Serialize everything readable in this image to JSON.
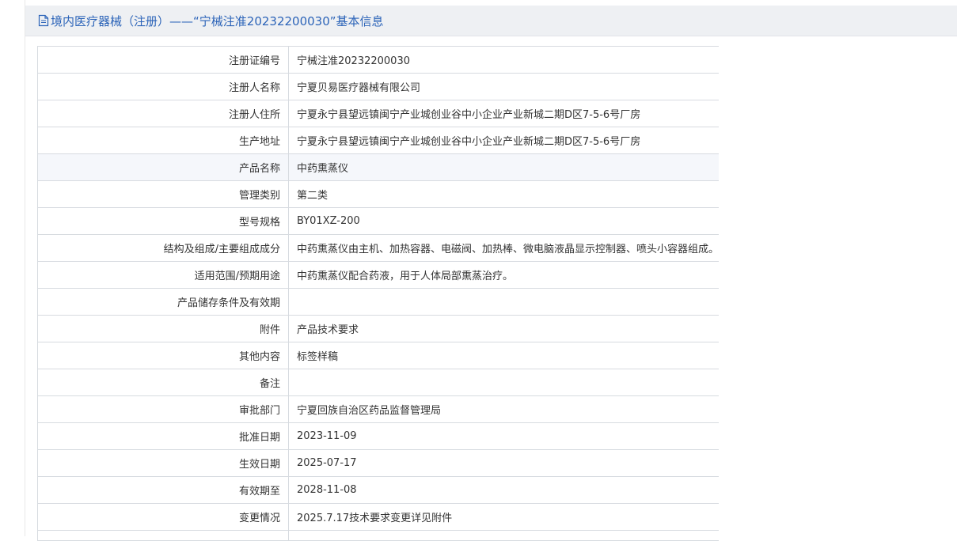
{
  "header": {
    "icon": "document-icon",
    "title": "境内医疗器械（注册）——“宁械注准20232200030”基本信息",
    "accent": "#2b63b8"
  },
  "rows": [
    {
      "label": "注册证编号",
      "value": "宁械注准20232200030"
    },
    {
      "label": "注册人名称",
      "value": "宁夏贝易医疗器械有限公司"
    },
    {
      "label": "注册人住所",
      "value": "宁夏永宁县望远镇闽宁产业城创业谷中小企业产业新城二期D区7-5-6号厂房"
    },
    {
      "label": "生产地址",
      "value": "宁夏永宁县望远镇闽宁产业城创业谷中小企业产业新城二期D区7-5-6号厂房"
    },
    {
      "label": "产品名称",
      "value": "中药熏蒸仪"
    },
    {
      "label": "管理类别",
      "value": "第二类"
    },
    {
      "label": "型号规格",
      "value": "BY01XZ-200"
    },
    {
      "label": "结构及组成/主要组成成分",
      "value": "中药熏蒸仪由主机、加热容器、电磁阀、加热棒、微电脑液晶显示控制器、喷头小容器组成。"
    },
    {
      "label": "适用范围/预期用途",
      "value": "中药熏蒸仪配合药液，用于人体局部熏蒸治疗。"
    },
    {
      "label": "产品储存条件及有效期",
      "value": ""
    },
    {
      "label": "附件",
      "value": "产品技术要求"
    },
    {
      "label": "其他内容",
      "value": "标签样稿"
    },
    {
      "label": "备注",
      "value": ""
    },
    {
      "label": "审批部门",
      "value": "宁夏回族自治区药品监督管理局"
    },
    {
      "label": "批准日期",
      "value": "2023-11-09"
    },
    {
      "label": "生效日期",
      "value": "2025-07-17"
    },
    {
      "label": "有效期至",
      "value": "2028-11-08"
    },
    {
      "label": "变更情况",
      "value": "2025.7.17技术要求变更详见附件"
    }
  ]
}
